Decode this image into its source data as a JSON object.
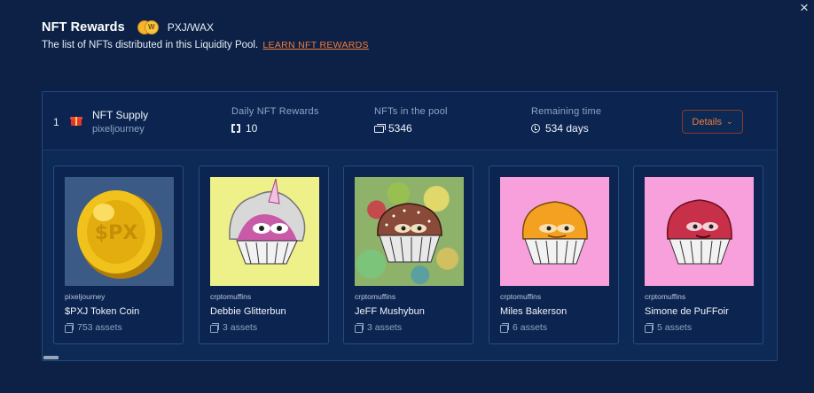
{
  "header": {
    "title": "NFT Rewards",
    "pair": "PXJ/WAX",
    "coin_letter": "W",
    "subtitle": "The list of NFTs distributed in this Liquidity Pool.",
    "learn_link": "LEARN NFT REWARDS"
  },
  "close_icon": "×",
  "pool": {
    "rank": "1",
    "name": "NFT Supply",
    "collection": "pixeljourney",
    "stats": {
      "daily": {
        "label": "Daily NFT Rewards",
        "value": "10"
      },
      "in_pool": {
        "label": "NFTs in the pool",
        "value": "5346"
      },
      "remaining": {
        "label": "Remaining time",
        "value": "534 days"
      }
    },
    "details_label": "Details",
    "details_chevron": "⌄"
  },
  "cards": [
    {
      "collection": "pixeljourney",
      "name": "$PXJ Token Coin",
      "assets": "753 assets"
    },
    {
      "collection": "crptomuffins",
      "name": "Debbie Glitterbun",
      "assets": "3 assets"
    },
    {
      "collection": "crptomuffins",
      "name": "JeFF Mushybun",
      "assets": "3 assets"
    },
    {
      "collection": "crptomuffins",
      "name": "Miles Bakerson",
      "assets": "6 assets"
    },
    {
      "collection": "crptomuffins",
      "name": "Simone de PuFFoir",
      "assets": "5 assets"
    }
  ],
  "colors": {
    "background": "#0c2145",
    "accent": "#f47a39",
    "panel": "#0d2a57"
  },
  "icons": [
    "close-icon",
    "coin-icon",
    "gift-icon",
    "stack-icon",
    "clock-icon",
    "chevron-down-icon",
    "copy-icon"
  ]
}
